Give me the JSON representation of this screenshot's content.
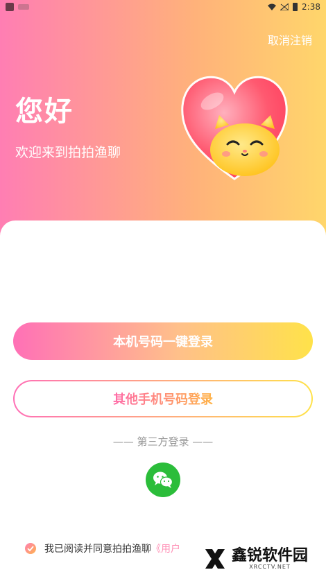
{
  "status_bar": {
    "time": "2:38"
  },
  "header": {
    "cancel_label": "取消注销"
  },
  "hero": {
    "greeting": "您好",
    "welcome": "欢迎来到拍拍渔聊"
  },
  "actions": {
    "one_tap_login": "本机号码一键登录",
    "other_phone_login": "其他手机号码登录"
  },
  "third_party": {
    "label": "—— 第三方登录 ——"
  },
  "agreement": {
    "text": "我已阅读并同意拍拍渔聊",
    "link_text": "《用户"
  },
  "watermark": {
    "cn": "鑫锐软件园",
    "en": "XRCCTV.NET"
  },
  "colors": {
    "pink": "#ff7eb3",
    "orange": "#ffb27a",
    "yellow": "#ffe24a",
    "wechat_green": "#2bbd3a"
  }
}
